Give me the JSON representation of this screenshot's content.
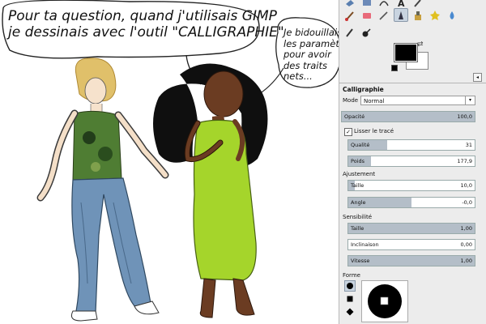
{
  "comic": {
    "bubble1_lines": [
      "Pour ta question, quand j'utilisais GIMP",
      "je dessinais avec l'outil \"CALLIGRAPHIE\""
    ],
    "bubble2_lines": [
      "Je bidouillais",
      "les paramètres",
      "pour avoir",
      "des traits",
      "nets..."
    ]
  },
  "panel": {
    "tool_icons_row1": [
      "fuzzy-select-icon",
      "foreground-select-icon",
      "paths-icon",
      "text-icon",
      "color-picker-icon"
    ],
    "tool_icons_row2": [
      "paintbrush-icon",
      "eraser-icon",
      "airbrush-icon",
      "ink-icon",
      "clone-icon",
      "heal-icon",
      "blur-icon"
    ],
    "tool_icons_row3": [
      "smudge-icon",
      "dodge-burn-icon"
    ],
    "active_tool": "ink-icon",
    "foreground_color": "#000000",
    "background_color": "#ffffff",
    "tool_options_title": "Calligraphie",
    "mode_label": "Mode",
    "mode_value": "Normal",
    "opacity": {
      "label": "Opacité",
      "value": "100,0",
      "fraction": 1.0
    },
    "smooth_checkbox": {
      "label": "Lisser le tracé",
      "checked": true
    },
    "quality": {
      "label": "Qualité",
      "value": "31",
      "fraction": 0.31
    },
    "weight": {
      "label": "Poids",
      "value": "177,9",
      "fraction": 0.18
    },
    "adjustment_title": "Ajustement",
    "size": {
      "label": "Taille",
      "value": "10,0",
      "fraction": 0.05
    },
    "angle": {
      "label": "Angle",
      "value": "-0,0",
      "fraction": 0.5
    },
    "sensitivity_title": "Sensibilité",
    "sens_size": {
      "label": "Taille",
      "value": "1,00",
      "fraction": 1.0
    },
    "tilt": {
      "label": "Inclinaison",
      "value": "0,00",
      "fraction": 0.0
    },
    "speed": {
      "label": "Vitesse",
      "value": "1,00",
      "fraction": 1.0
    },
    "shape_title": "Forme",
    "shapes": [
      "circle-shape-icon",
      "square-shape-icon",
      "diamond-shape-icon"
    ],
    "active_shape": "circle-shape-icon"
  }
}
